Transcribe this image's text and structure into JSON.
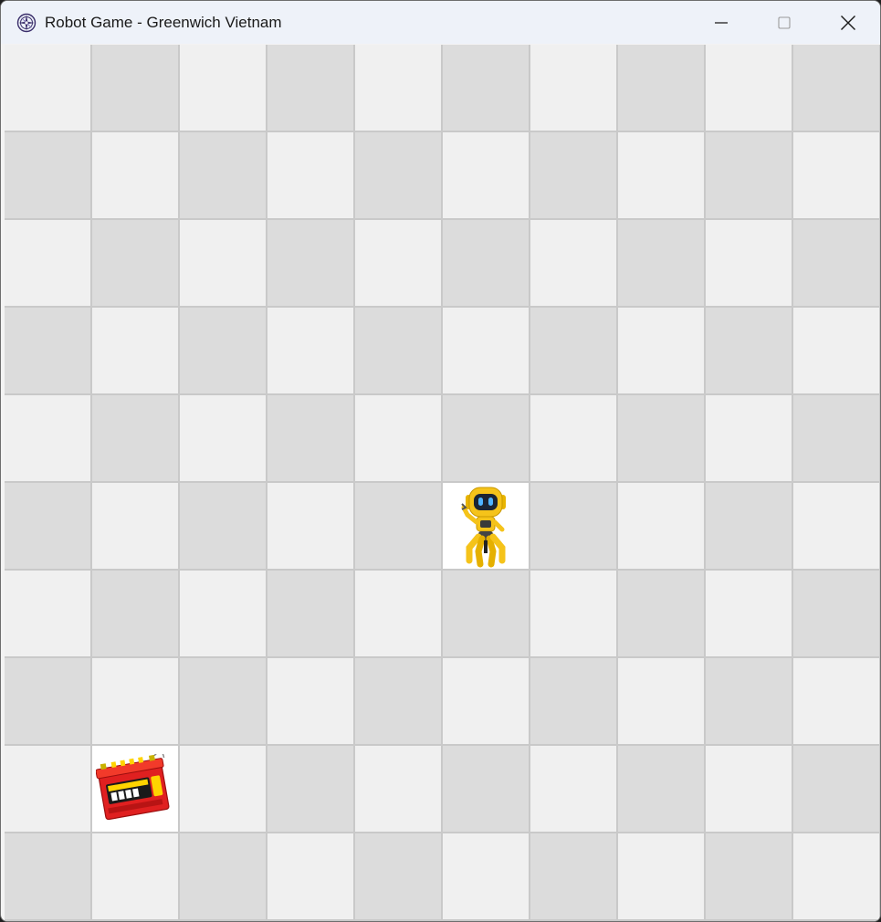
{
  "window": {
    "title": "Robot Game - Greenwich Vietnam",
    "icon": "compass-rose-icon",
    "controls": [
      {
        "name": "minimize-button",
        "icon": "minimize-icon"
      },
      {
        "name": "maximize-button",
        "icon": "maximize-icon"
      },
      {
        "name": "close-button",
        "icon": "close-icon"
      }
    ]
  },
  "board": {
    "rows": 10,
    "cols": 10,
    "colors": {
      "light": "#f0f0f0",
      "dark": "#dcdcdc",
      "occupied": "#ffffff",
      "grid_line": "#c9c9c9"
    },
    "pieces": [
      {
        "type": "robot",
        "icon": "robot-icon",
        "row": 5,
        "col": 5
      },
      {
        "type": "battery",
        "icon": "battery-icon",
        "row": 8,
        "col": 1
      }
    ]
  }
}
